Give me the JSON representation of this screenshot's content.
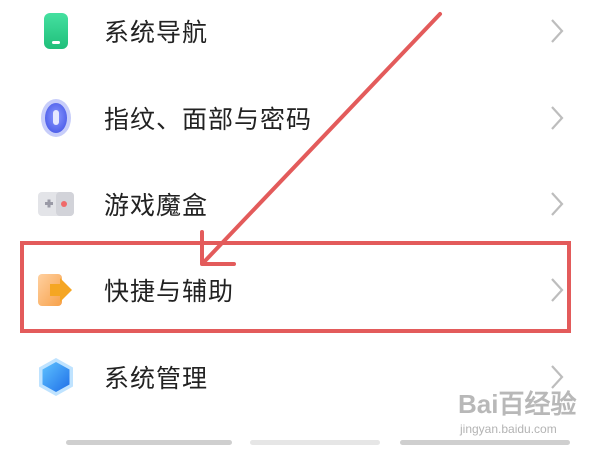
{
  "settings": {
    "items": [
      {
        "label": "系统导航",
        "icon": "phone-navigation-icon"
      },
      {
        "label": "指纹、面部与密码",
        "icon": "fingerprint-icon"
      },
      {
        "label": "游戏魔盒",
        "icon": "game-box-icon"
      },
      {
        "label": "快捷与辅助",
        "icon": "shortcut-assist-icon"
      },
      {
        "label": "系统管理",
        "icon": "system-management-icon"
      }
    ]
  },
  "annotation": {
    "highlight_color": "#e35b5b",
    "highlighted_item": "快捷与辅助"
  },
  "watermark": {
    "logo": "Bai百经验",
    "url": "jingyan.baidu.com"
  },
  "colors": {
    "navigation_icon": "#2ecf8b",
    "fingerprint_icon": "#5b6cf0",
    "game_box_icon": "#d9d9de",
    "shortcut_icon": "#f5a623",
    "system_management_icon": "#2f8ff5",
    "chevron": "#bdbdbd"
  }
}
